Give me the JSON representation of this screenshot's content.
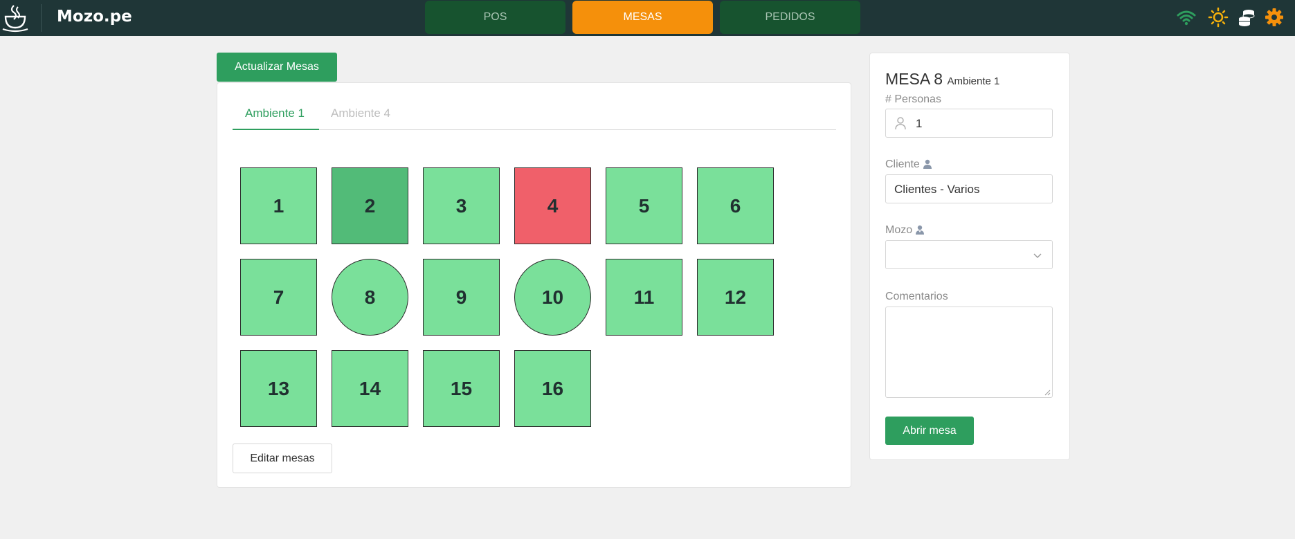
{
  "brand": "Mozo.pe",
  "nav": [
    {
      "label": "POS",
      "active": false
    },
    {
      "label": "MESAS",
      "active": true
    },
    {
      "label": "PEDIDOS",
      "active": false
    }
  ],
  "toolbar_icons": [
    "wifi-icon",
    "sun-icon",
    "coins-icon",
    "gear-icon"
  ],
  "colors": {
    "topbar": "#1f3637",
    "accent_green": "#2e9e5e",
    "active_tab": "#f5900b",
    "table_free": "#7ae09a",
    "table_selected": "#52bb78",
    "table_occupied": "#f0606a",
    "icon_orange": "#f5900b",
    "wifi_green": "#2e9e5e"
  },
  "update_button": "Actualizar Mesas",
  "tabs": [
    {
      "label": "Ambiente 1",
      "active": true
    },
    {
      "label": "Ambiente 4",
      "active": false
    }
  ],
  "tables": [
    {
      "number": "1",
      "shape": "square",
      "status": "free"
    },
    {
      "number": "2",
      "shape": "square",
      "status": "selected"
    },
    {
      "number": "3",
      "shape": "square",
      "status": "free"
    },
    {
      "number": "4",
      "shape": "square",
      "status": "occupied"
    },
    {
      "number": "5",
      "shape": "square",
      "status": "free"
    },
    {
      "number": "6",
      "shape": "square",
      "status": "free"
    },
    {
      "number": "7",
      "shape": "square",
      "status": "free"
    },
    {
      "number": "8",
      "shape": "round",
      "status": "free"
    },
    {
      "number": "9",
      "shape": "square",
      "status": "free"
    },
    {
      "number": "10",
      "shape": "round",
      "status": "free"
    },
    {
      "number": "11",
      "shape": "square",
      "status": "free"
    },
    {
      "number": "12",
      "shape": "square",
      "status": "free"
    },
    {
      "number": "13",
      "shape": "square",
      "status": "free"
    },
    {
      "number": "14",
      "shape": "square",
      "status": "free"
    },
    {
      "number": "15",
      "shape": "square",
      "status": "free"
    },
    {
      "number": "16",
      "shape": "square",
      "status": "free"
    }
  ],
  "edit_button": "Editar mesas",
  "side": {
    "title": "MESA 8",
    "subtitle": "Ambiente 1",
    "personas_label": "# Personas",
    "personas_value": "1",
    "cliente_label": "Cliente",
    "cliente_value": "Clientes - Varios",
    "mozo_label": "Mozo",
    "mozo_value": "",
    "comentarios_label": "Comentarios",
    "comentarios_value": "",
    "open_button": "Abrir mesa"
  }
}
